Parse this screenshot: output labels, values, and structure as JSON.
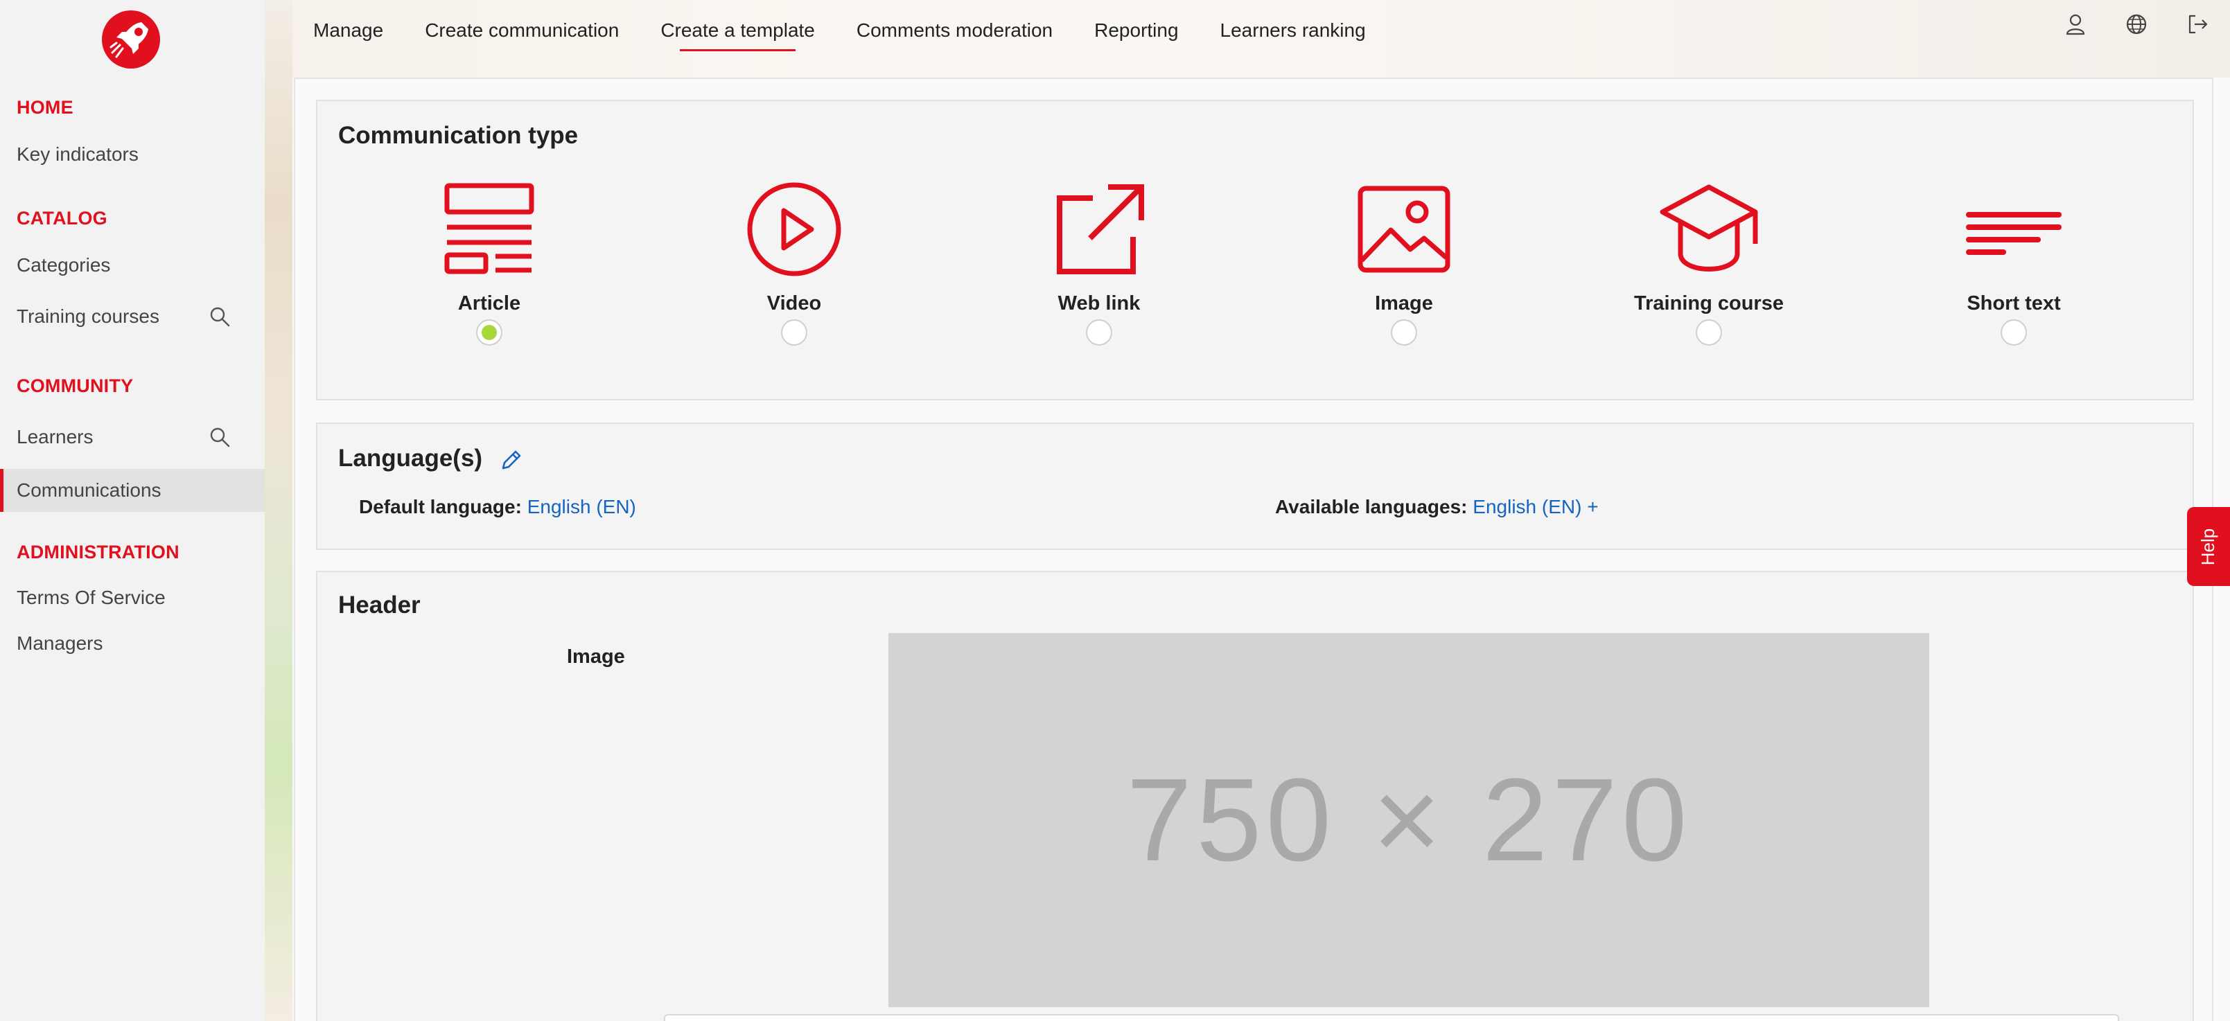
{
  "sidebar": {
    "sections": [
      {
        "title": "HOME",
        "items": [
          {
            "label": "Key indicators"
          }
        ]
      },
      {
        "title": "CATALOG",
        "items": [
          {
            "label": "Categories"
          },
          {
            "label": "Training courses"
          }
        ]
      },
      {
        "title": "COMMUNITY",
        "items": [
          {
            "label": "Learners"
          },
          {
            "label": "Communications"
          }
        ]
      },
      {
        "title": "ADMINISTRATION",
        "items": [
          {
            "label": "Terms Of Service"
          },
          {
            "label": "Managers"
          }
        ]
      }
    ]
  },
  "topnav": {
    "items": [
      "Manage",
      "Create communication",
      "Create a template",
      "Comments moderation",
      "Reporting",
      "Learners ranking"
    ],
    "active": "Create a template"
  },
  "communication_type": {
    "title": "Communication type",
    "types": [
      {
        "label": "Article",
        "icon": "article-icon",
        "selected": true
      },
      {
        "label": "Video",
        "icon": "video-play-icon",
        "selected": false
      },
      {
        "label": "Web link",
        "icon": "external-link-icon",
        "selected": false
      },
      {
        "label": "Image",
        "icon": "image-icon",
        "selected": false
      },
      {
        "label": "Training course",
        "icon": "graduation-cap-icon",
        "selected": false
      },
      {
        "label": "Short text",
        "icon": "short-text-icon",
        "selected": false
      }
    ]
  },
  "languages": {
    "title": "Language(s)",
    "default_label": "Default language:",
    "default_value": "English (EN)",
    "available_label": "Available languages:",
    "available_value": "English (EN) +"
  },
  "header": {
    "title": "Header",
    "image_label": "Image",
    "placeholder_text": "750 × 270"
  },
  "help": {
    "label": "Help"
  },
  "colors": {
    "accent": "#e0101f",
    "link": "#1565c0",
    "selected_radio": "#a6d83e"
  }
}
